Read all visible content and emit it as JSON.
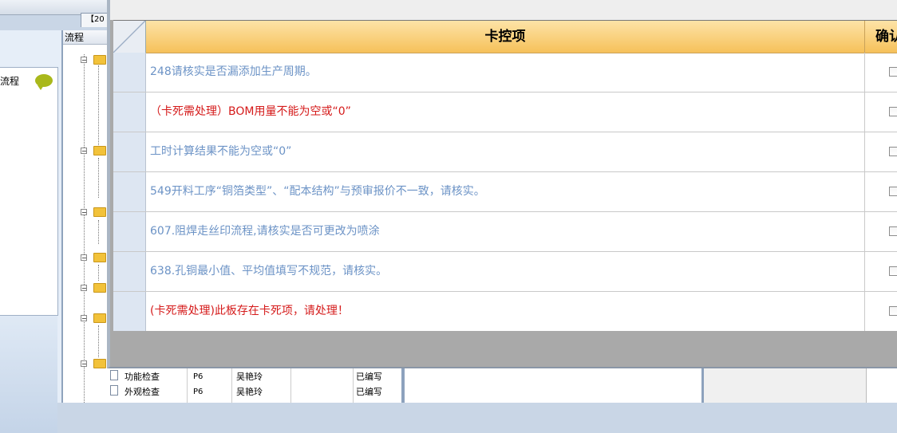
{
  "background": {
    "tab_label": "【20",
    "left_panel_label": "流程",
    "tree_header": "流程",
    "rows": [
      {
        "name": "功能检查",
        "code": "P6",
        "person": "吴艳玲",
        "status": "已编写"
      },
      {
        "name": "外观检查",
        "code": "P6",
        "person": "吴艳玲",
        "status": "已编写"
      }
    ]
  },
  "dialog": {
    "header_item": "卡控项",
    "header_confirm": "确认",
    "rows": [
      {
        "text": "248请核实是否漏添加生产周期。",
        "color": "#6c93c6",
        "checked": false
      },
      {
        "text": "（卡死需处理）BOM用量不能为空或“0”",
        "color": "#d51b1b",
        "checked": false
      },
      {
        "text": "工时计算结果不能为空或“0”",
        "color": "#6c93c6",
        "checked": false
      },
      {
        "text": "549开料工序“铜箔类型”、“配本结构”与预审报价不一致，请核实。",
        "color": "#6c93c6",
        "checked": false
      },
      {
        "text": "607.阻焊走丝印流程,请核实是否可更改为喷涂",
        "color": "#6c93c6",
        "checked": false
      },
      {
        "text": "638.孔铜最小值、平均值填写不规范，请核实。",
        "color": "#6c93c6",
        "checked": false
      },
      {
        "text": "(卡死需处理)此板存在卡死项，请处理！",
        "color": "#d51b1b",
        "checked": false
      }
    ]
  },
  "colors": {
    "header_gold": "#f6c15a",
    "row_blue": "#6c93c6",
    "row_red": "#d51b1b"
  }
}
